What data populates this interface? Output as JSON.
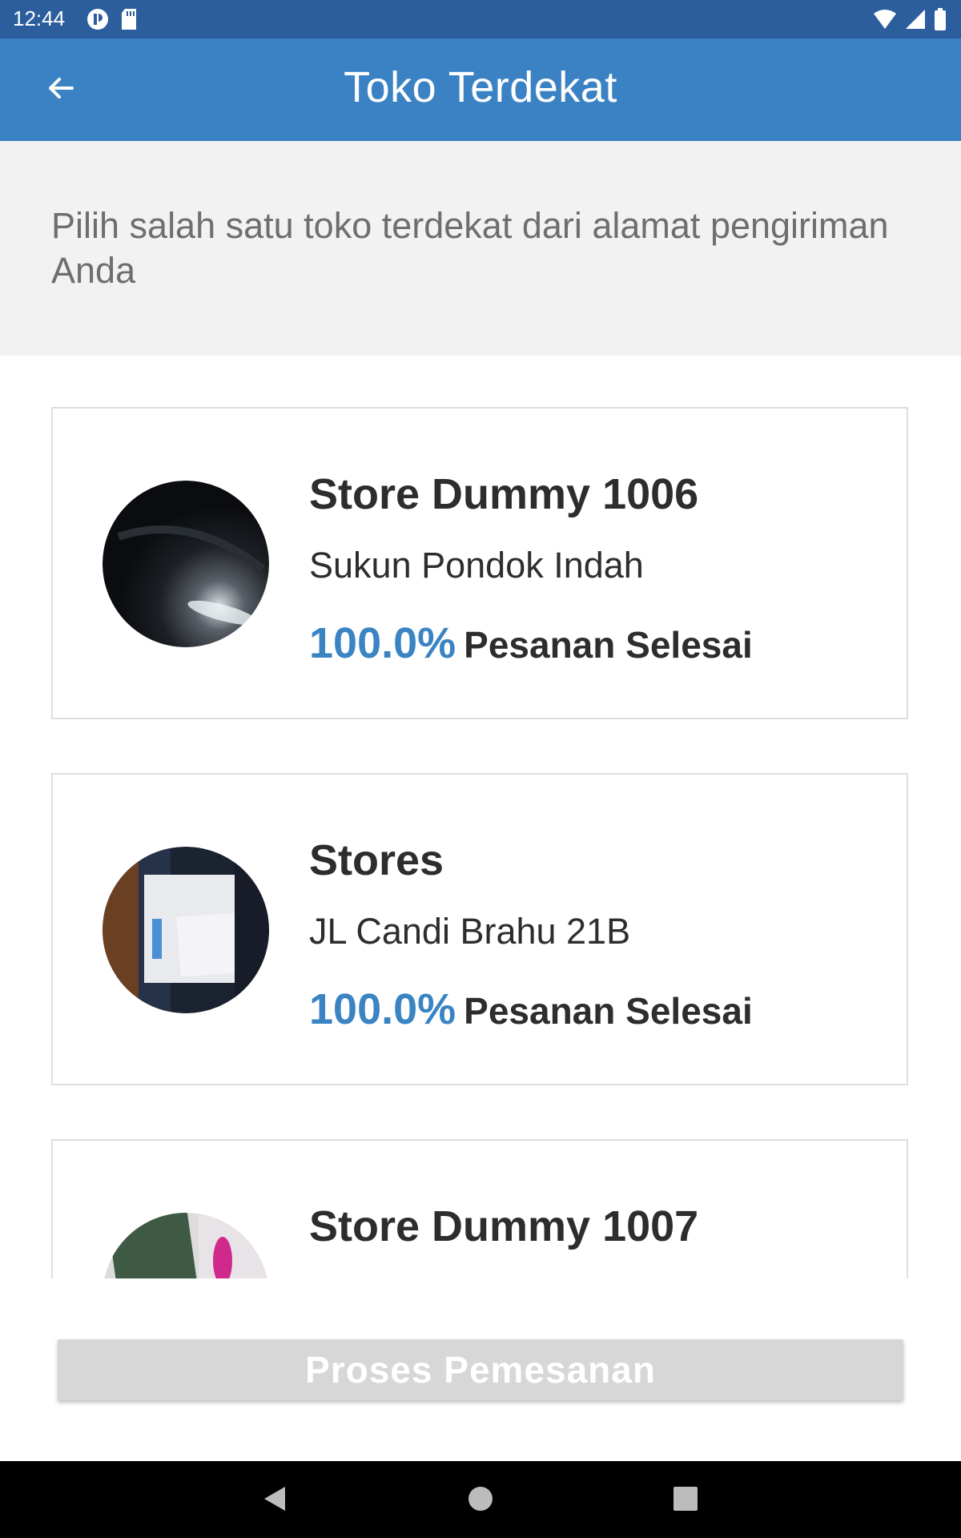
{
  "status_bar": {
    "time": "12:44",
    "icons_left": [
      "media-icon",
      "sd-card-icon"
    ],
    "icons_right": [
      "wifi-icon",
      "signal-icon",
      "battery-icon"
    ]
  },
  "app_bar": {
    "title": "Toko Terdekat",
    "back_icon": "arrow-left-icon"
  },
  "instruction": "Pilih salah satu toko terdekat dari alamat pengiriman Anda",
  "stores": [
    {
      "name": "Store Dummy 1006",
      "address": "Sukun Pondok Indah",
      "percent": "100.0%",
      "status_label": "Pesanan Selesai"
    },
    {
      "name": "Stores",
      "address": "JL Candi Brahu 21B",
      "percent": "100.0%",
      "status_label": "Pesanan Selesai"
    },
    {
      "name": "Store Dummy 1007",
      "address": "",
      "percent": "",
      "status_label": ""
    }
  ],
  "process_button": "Proses Pemesanan",
  "colors": {
    "status_bar": "#2c5e9e",
    "app_bar": "#3b82c4",
    "accent_percent": "#3a84c3",
    "button_disabled": "#d7d7d7"
  },
  "nav_bar": [
    "back-icon",
    "home-icon",
    "recents-icon"
  ]
}
